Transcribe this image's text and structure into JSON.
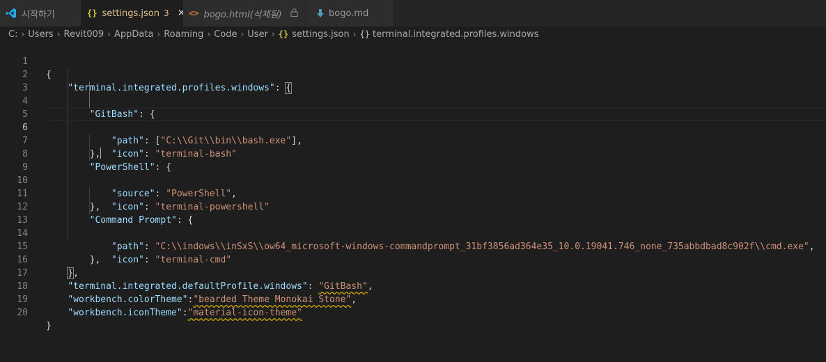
{
  "tabs": [
    {
      "label": "시작하기",
      "icon": "vscode-logo-icon",
      "active": false
    },
    {
      "label": "settings.json",
      "icon": "json-braces-icon",
      "badge": "3",
      "active": true
    },
    {
      "label": "bogo.html(삭제됨)",
      "icon": "html-icon",
      "active": false
    },
    {
      "label": "bogo.md",
      "icon": "markdown-icon",
      "active": false
    }
  ],
  "breadcrumb": {
    "items": [
      "C:",
      "Users",
      "Revit009",
      "AppData",
      "Roaming",
      "Code",
      "User",
      "settings.json",
      "terminal.integrated.profiles.windows"
    ]
  },
  "editor": {
    "line_numbers": [
      "1",
      "2",
      "3",
      "4",
      "5",
      "6",
      "7",
      "8",
      "9",
      "10",
      "11",
      "12",
      "13",
      "14",
      "15",
      "16",
      "17",
      "18",
      "19",
      "20"
    ],
    "current_line": 6,
    "tokens": {
      "l2_key": "\"terminal.integrated.profiles.windows\"",
      "l3_key": "\"GitBash\"",
      "l4_key": "\"path\"",
      "l4_val": "\"C:\\\\Git\\\\bin\\\\bash.exe\"",
      "l5_key": "\"icon\"",
      "l5_val": "\"terminal-bash\"",
      "l7_key": "\"PowerShell\"",
      "l8_key": "\"source\"",
      "l8_val": "\"PowerShell\"",
      "l9_key": "\"icon\"",
      "l9_val": "\"terminal-powershell\"",
      "l11_key": "\"Command Prompt\"",
      "l12_key": "\"path\"",
      "l12_val": "\"C:\\\\indows\\\\inSxS\\\\ow64_microsoft-windows-commandprompt_31bf3856ad364e35_10.0.19041.746_none_735abbdbad8c902f\\\\cmd.exe\"",
      "l13_key": "\"icon\"",
      "l13_val": "\"terminal-cmd\"",
      "l17_key": "\"terminal.integrated.defaultProfile.windows\"",
      "l17_val": "\"GitBash\"",
      "l18_key": "\"workbench.colorTheme\"",
      "l18_val": "\"bearded Theme Monokai Stone\"",
      "l19_key": "\"workbench.iconTheme\"",
      "l19_val": "\"material-icon-theme\""
    }
  },
  "colors": {
    "background": "#1e1e1e",
    "key": "#9cdcfe",
    "string": "#ce9178",
    "modified": "#e2c08d",
    "json_icon": "#cbcb41"
  }
}
